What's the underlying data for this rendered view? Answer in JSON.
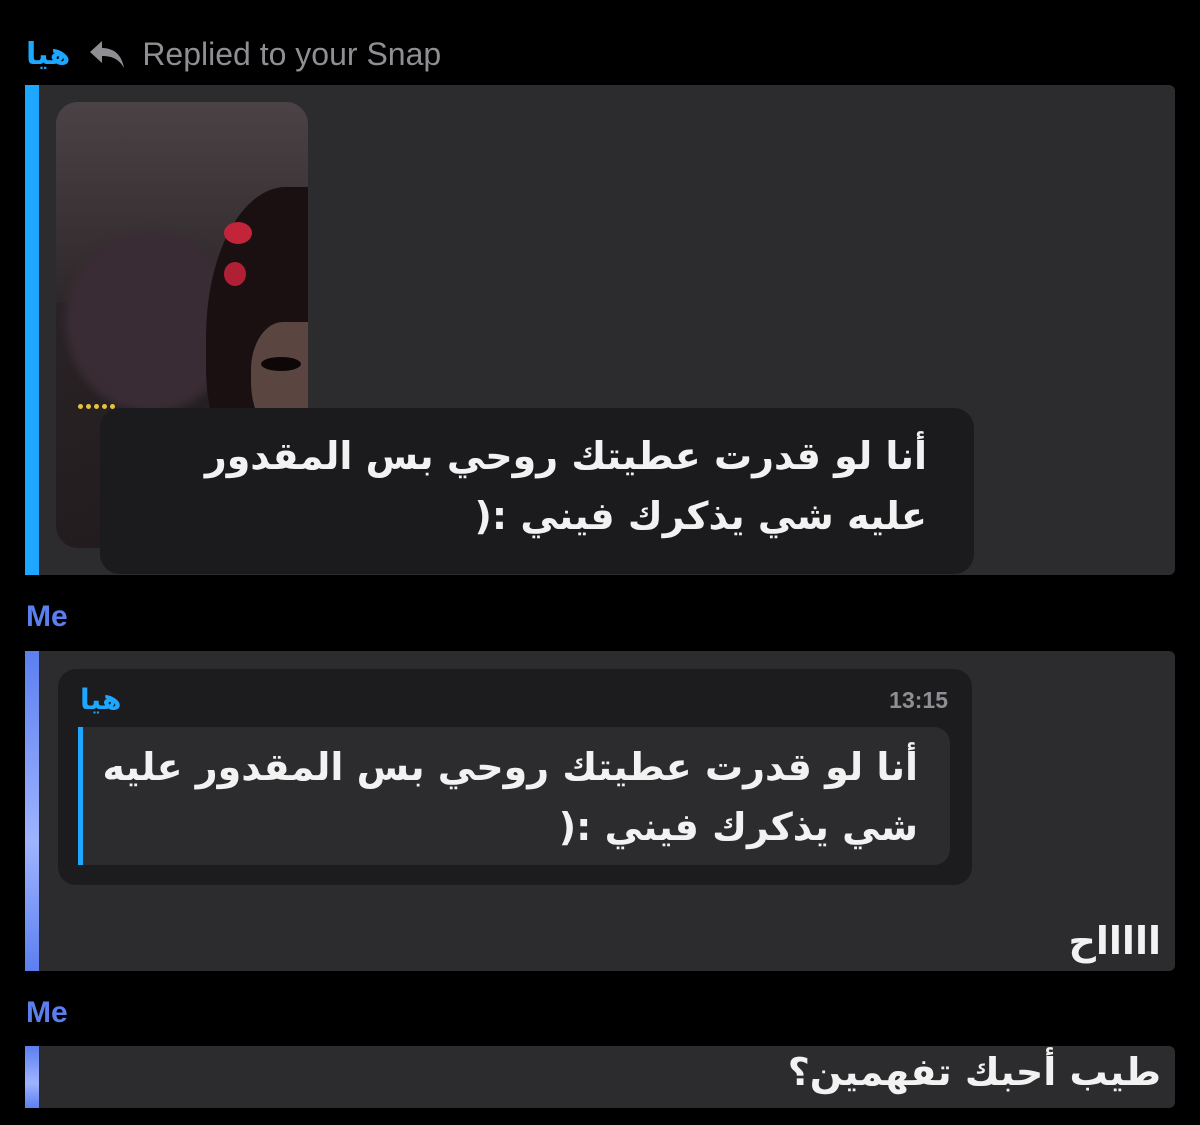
{
  "header": {
    "sender_name": "هيا",
    "icon": "reply-arrow-icon",
    "replied_label": "Replied to your Snap"
  },
  "snap_reply": {
    "caption": "أنا لو قدرت عطيتك روحي بس المقدور عليه شي يذكرك فيني :("
  },
  "messages": [
    {
      "sender": "Me",
      "quote": {
        "sender": "هيا",
        "time": "13:15",
        "text": "أنا لو قدرت عطيتك روحي بس المقدور عليه شي يذكرك فيني :("
      },
      "text": "اااااح"
    },
    {
      "sender": "Me",
      "text": "طيب أحبك تفهمين؟"
    }
  ],
  "colors": {
    "background": "#000000",
    "bubble": "#2c2c2e",
    "friend_accent": "#1ea7ff",
    "me_accent": "#5c7ff0",
    "muted_text": "#8e8e93"
  }
}
